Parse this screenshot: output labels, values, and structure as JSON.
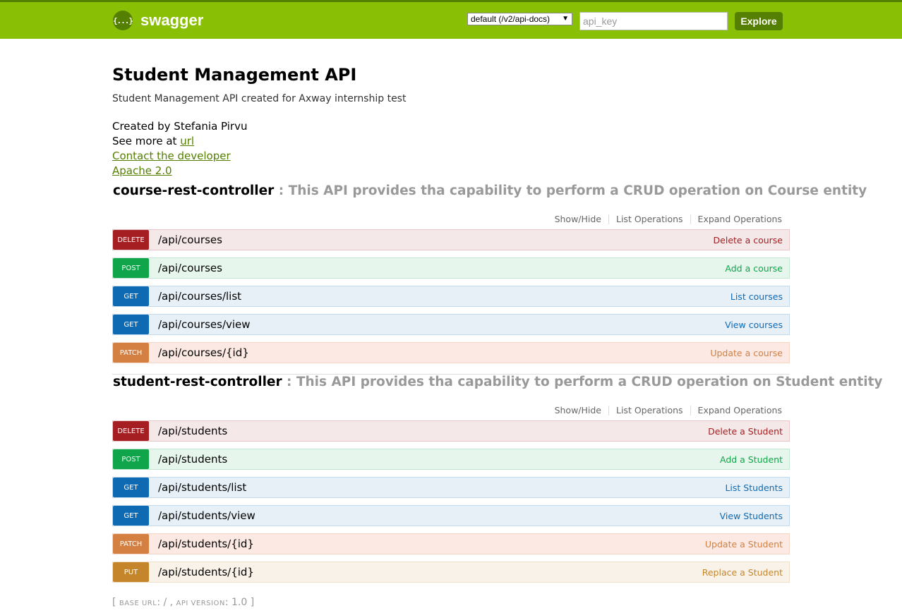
{
  "header": {
    "logo_glyph": "{...}",
    "logo_text": "swagger",
    "spec_select": "default (/v2/api-docs)",
    "api_key_placeholder": "api_key",
    "explore_label": "Explore",
    "colors": {
      "bar": "#89bf04",
      "accent": "#547f00"
    }
  },
  "info": {
    "title": "Student Management API",
    "description": "Student Management API created for Axway internship test",
    "created_by": "Created by Stefania Pirvu",
    "see_more_prefix": "See more at ",
    "see_more_link": "url",
    "contact_link": "Contact the developer",
    "license_link": "Apache 2.0"
  },
  "resource_links": {
    "show_hide": "Show/Hide",
    "list_ops": "List Operations",
    "expand_ops": "Expand Operations"
  },
  "resources": [
    {
      "name": "course-rest-controller",
      "description": " : This API provides tha capability to perform a CRUD operation on Course entity",
      "operations": [
        {
          "method": "DELETE",
          "path": "/api/courses",
          "summary": "Delete a course"
        },
        {
          "method": "POST",
          "path": "/api/courses",
          "summary": "Add a course"
        },
        {
          "method": "GET",
          "path": "/api/courses/list",
          "summary": "List courses"
        },
        {
          "method": "GET",
          "path": "/api/courses/view",
          "summary": "View courses"
        },
        {
          "method": "PATCH",
          "path": "/api/courses/{id}",
          "summary": "Update a course"
        }
      ]
    },
    {
      "name": "student-rest-controller",
      "description": " : This API provides tha capability to perform a CRUD operation on Student entity",
      "operations": [
        {
          "method": "DELETE",
          "path": "/api/students",
          "summary": "Delete a Student"
        },
        {
          "method": "POST",
          "path": "/api/students",
          "summary": "Add a Student"
        },
        {
          "method": "GET",
          "path": "/api/students/list",
          "summary": "List Students"
        },
        {
          "method": "GET",
          "path": "/api/students/view",
          "summary": "View Students"
        },
        {
          "method": "PATCH",
          "path": "/api/students/{id}",
          "summary": "Update a Student"
        },
        {
          "method": "PUT",
          "path": "/api/students/{id}",
          "summary": "Replace a Student"
        }
      ]
    }
  ],
  "footer": {
    "open": "[ ",
    "base_url_label": "base url",
    "base_url_value": ": / , ",
    "api_version_label": "api version",
    "api_version_value": ": 1.0 ]"
  }
}
